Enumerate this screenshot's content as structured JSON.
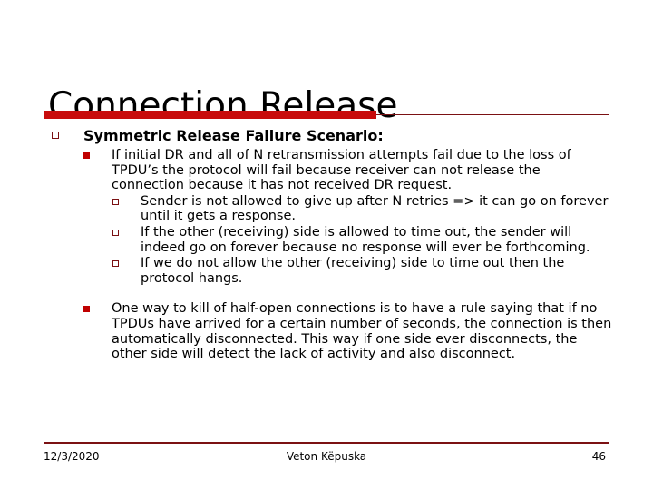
{
  "slide": {
    "title": "Connection Release",
    "accent_color": "#c80c0c",
    "rule_color": "#7b1113",
    "bullet_filled_color": "#c00000"
  },
  "content": {
    "heading": "Symmetric Release Failure Scenario:",
    "point1": "If initial DR and all of N retransmission attempts fail due to the loss of TPDU’s the protocol will fail because receiver can not release the connection because it has not received DR request.",
    "subpoints": [
      "Sender is not allowed to give up after N retries => it can go on forever until it gets a response.",
      "If the other (receiving) side is allowed to time out, the sender will indeed go on forever because no response will ever be forthcoming.",
      "If we do not allow the other (receiving) side to time out then the protocol hangs."
    ],
    "point2": "One way to kill of half-open connections is to have a rule saying that if no TPDUs have arrived for a certain number of seconds, the connection is then automatically disconnected. This way if one side ever disconnects, the other side will detect the lack of activity and also disconnect."
  },
  "footer": {
    "date": "12/3/2020",
    "author": "Veton Këpuska",
    "page_number": "46"
  }
}
